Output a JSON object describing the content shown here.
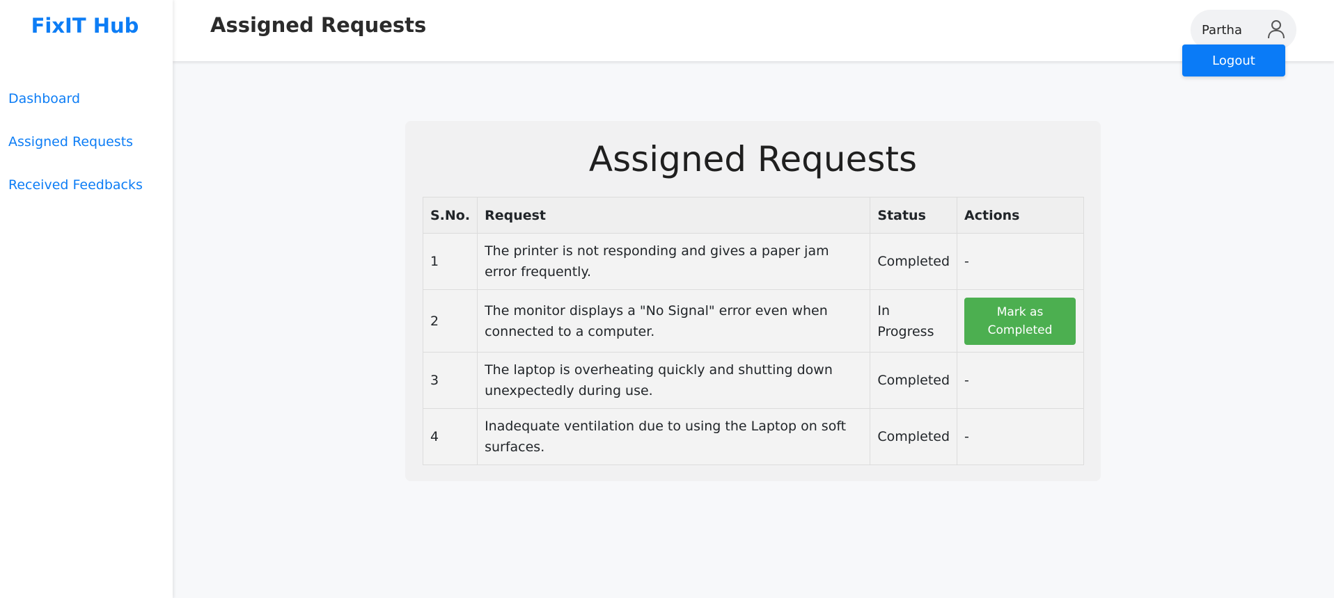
{
  "brand": "FixIT Hub",
  "sidebar": {
    "items": [
      {
        "label": "Dashboard"
      },
      {
        "label": "Assigned Requests"
      },
      {
        "label": "Received Feedbacks"
      }
    ]
  },
  "header": {
    "title": "Assigned Requests",
    "user": "Partha",
    "logout_label": "Logout"
  },
  "main": {
    "title": "Assigned Requests",
    "columns": [
      "S.No.",
      "Request",
      "Status",
      "Actions"
    ],
    "rows": [
      {
        "sno": "1",
        "request": "The printer is not responding and gives a paper jam error frequently.",
        "status": "Completed",
        "action": "-"
      },
      {
        "sno": "2",
        "request": "The monitor displays a \"No Signal\" error even when connected to a computer.",
        "status": "In Progress",
        "action": "Mark as Completed"
      },
      {
        "sno": "3",
        "request": "The laptop is overheating quickly and shutting down unexpectedly during use.",
        "status": "Completed",
        "action": "-"
      },
      {
        "sno": "4",
        "request": "Inadequate ventilation due to using the Laptop on soft surfaces.",
        "status": "Completed",
        "action": "-"
      }
    ]
  },
  "colors": {
    "accent": "#0d7df5",
    "success": "#4caf50"
  }
}
